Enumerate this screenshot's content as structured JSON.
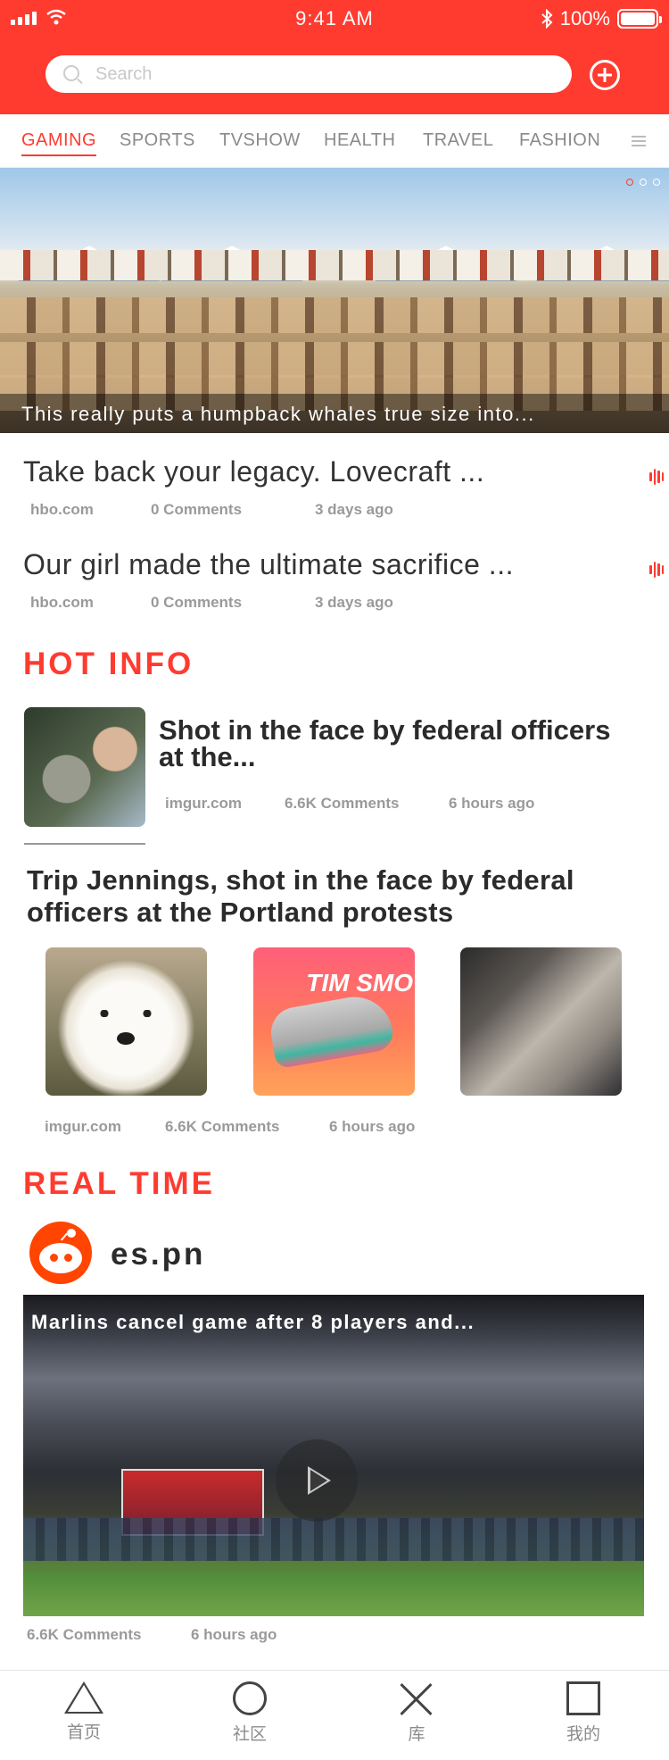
{
  "status_bar": {
    "time": "9:41 AM",
    "battery": "100%"
  },
  "search": {
    "placeholder": "Search"
  },
  "tabs": [
    "GAMING",
    "SPORTS",
    "TVSHOW",
    "HEALTH",
    "TRAVEL",
    "FASHION"
  ],
  "active_tab": "GAMING",
  "banner": {
    "caption": "This really puts a humpback whales true size into..."
  },
  "news": [
    {
      "title": "Take back your legacy. Lovecraft ...",
      "source": "hbo.com",
      "comments": "0 Comments",
      "time": "3 days ago"
    },
    {
      "title": "Our girl made the ultimate sacrifice ...",
      "source": "hbo.com",
      "comments": "0 Comments",
      "time": "3 days ago"
    }
  ],
  "hot_info": {
    "section_title": "HOT INFO",
    "feature": {
      "title": "Shot in the face by federal officers at the...",
      "source": "imgur.com",
      "comments": "6.6K Comments",
      "time": "6 hours ago"
    },
    "article": {
      "title": "Trip Jennings, shot in the face by federal officers at the Portland protests",
      "source": "imgur.com",
      "comments": "6.6K Comments",
      "time": "6 hours ago",
      "shoe_text": "TIM SMO"
    }
  },
  "real_time": {
    "section_title": "REAL TIME",
    "channel": "es.pn",
    "video_caption": "Marlins cancel game after 8 players and...",
    "comments": "6.6K Comments",
    "time": "6 hours ago"
  },
  "bottom_nav": [
    {
      "label": "首页",
      "icon": "triangle-icon"
    },
    {
      "label": "社区",
      "icon": "circle-icon"
    },
    {
      "label": "库",
      "icon": "cross-icon"
    },
    {
      "label": "我的",
      "icon": "square-icon"
    }
  ],
  "colors": {
    "accent": "#ff3b30",
    "meta_gray": "#9a9a9a"
  }
}
